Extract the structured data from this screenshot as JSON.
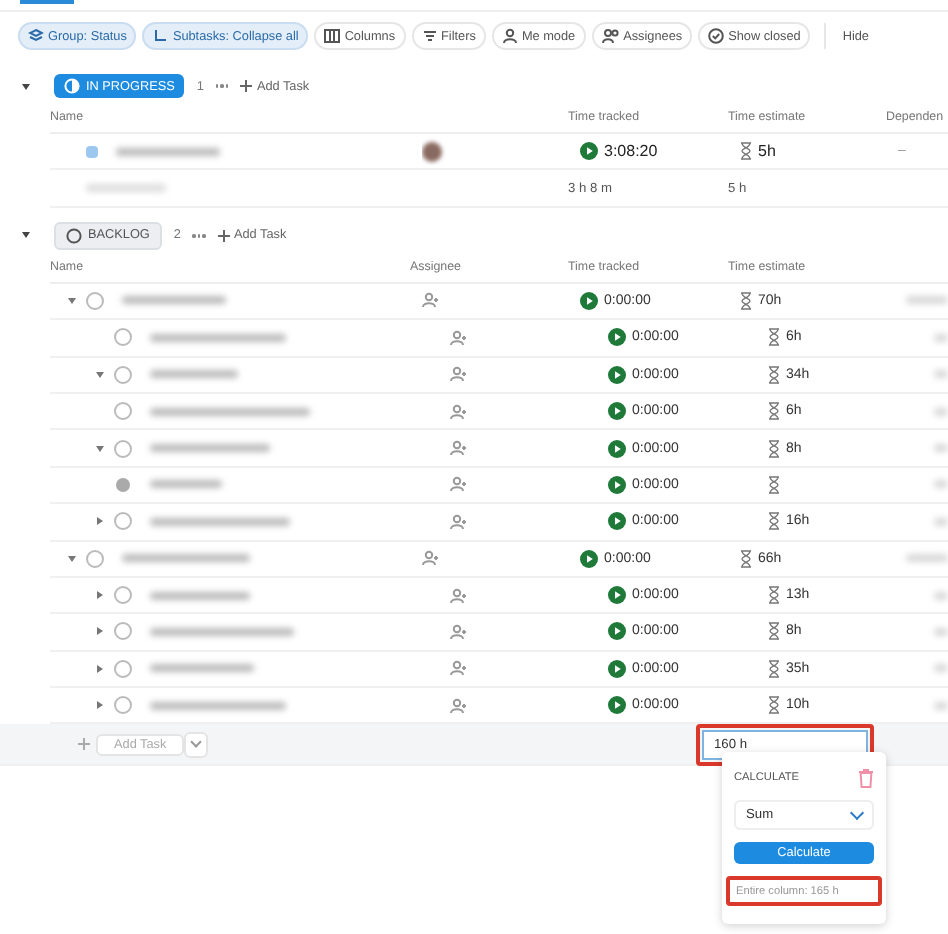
{
  "toolbar": [
    {
      "label": "Group: Status",
      "kind": "group",
      "active": true
    },
    {
      "label": "Subtasks: Collapse all",
      "kind": "subtasks",
      "active": true
    },
    {
      "label": "Columns",
      "kind": "columns",
      "active": false
    },
    {
      "label": "Filters",
      "kind": "filters",
      "active": false
    },
    {
      "label": "Me mode",
      "kind": "me",
      "active": false
    },
    {
      "label": "Assignees",
      "kind": "assignees",
      "active": false
    },
    {
      "label": "Show closed",
      "kind": "closed",
      "active": false
    },
    {
      "label": "Hide",
      "kind": "plain",
      "active": false
    }
  ],
  "groups": [
    {
      "status": "IN PROGRESS",
      "kind": "progress",
      "count": "1",
      "expanded": true,
      "add_task": "Add Task",
      "columns": [
        "Name",
        "",
        "Time tracked",
        "Time estimate",
        "Dependen"
      ],
      "rows": [
        {
          "tracked": "3:08:20",
          "estimate": "5h",
          "column_5": "–",
          "avatar": true
        }
      ],
      "summary": {
        "tracked": "3 h 8 m",
        "estimate": "5 h"
      }
    },
    {
      "status": "BACKLOG",
      "kind": "backlog",
      "count": "2",
      "expanded": true,
      "add_task": "Add Task",
      "columns": [
        "Name",
        "Assignee",
        "Time tracked",
        "Time estimate",
        ""
      ],
      "rows": [
        {
          "tracked": "0:00:00",
          "estimate": "70h",
          "expanded": true,
          "children": [
            {
              "tracked": "0:00:00",
              "estimate": "6h"
            },
            {
              "tracked": "0:00:00",
              "estimate": "34h",
              "expanded": true
            },
            {
              "tracked": "0:00:00",
              "estimate": "6h"
            },
            {
              "tracked": "0:00:00",
              "estimate": "8h",
              "expanded": true
            },
            {
              "tracked": "0:00:00",
              "done": true
            },
            {
              "tracked": "0:00:00",
              "estimate": "16h",
              "expanded": false
            }
          ]
        },
        {
          "tracked": "0:00:00",
          "estimate": "66h",
          "expanded": true,
          "children": [
            {
              "tracked": "0:00:00",
              "estimate": "13h",
              "expanded": false
            },
            {
              "tracked": "0:00:00",
              "estimate": "8h",
              "expanded": false
            },
            {
              "tracked": "0:00:00",
              "estimate": "35h",
              "expanded": false
            },
            {
              "tracked": "0:00:00",
              "estimate": "10h",
              "expanded": false
            }
          ]
        }
      ],
      "footer": {
        "add_task": "Add Task",
        "estimate_total": "160 h"
      }
    }
  ],
  "popup": {
    "title": "CALCULATE",
    "select": "Sum",
    "button": "Calculate",
    "note": "Entire column: 165 h"
  }
}
